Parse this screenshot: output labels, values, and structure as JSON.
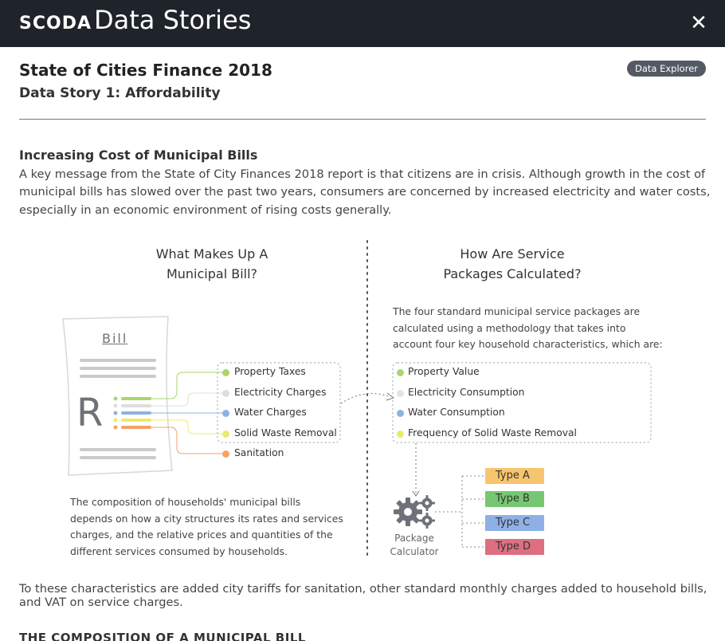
{
  "header": {
    "logo": "SCODA",
    "title": "Data Stories",
    "close_icon": "close-icon"
  },
  "page": {
    "title": "State of Cities Finance 2018",
    "subtitle": "Data Story 1: Affordability",
    "badge": "Data Explorer"
  },
  "section": {
    "heading": "Increasing Cost of Municipal Bills",
    "intro": "A key message from the State of City Finances 2018 report is that citizens are in crisis. Although growth in the cost of municipal bills has slowed over the past two years, consumers are concerned by increased electricity and water costs, especially in an economic environment of rising costs generally."
  },
  "diagram": {
    "left": {
      "title_line1": "What Makes Up A",
      "title_line2": "Municipal Bill?",
      "bill_label": "Bill",
      "bill_symbol": "R",
      "items": [
        {
          "label": "Property Taxes",
          "color": "#a9d66e"
        },
        {
          "label": "Electricity Charges",
          "color": "#dcdedf"
        },
        {
          "label": "Water Charges",
          "color": "#8fb0e6"
        },
        {
          "label": "Solid Waste Removal",
          "color": "#e9ec6b"
        },
        {
          "label": "Sanitation",
          "color": "#f3a366"
        }
      ],
      "description": "The composition of households' municipal bills depends on how a city structures its rates and services charges, and the relative prices and quantities of the different services consumed by households."
    },
    "right": {
      "title_line1": "How Are Service",
      "title_line2": "Packages Calculated?",
      "description": "The four standard municipal service packages are calculated using a methodology that takes into account four key household characteristics, which are:",
      "items": [
        {
          "label": "Property Value",
          "color": "#a9d66e"
        },
        {
          "label": "Electricity Consumption",
          "color": "#e2e3e4"
        },
        {
          "label": "Water Consumption",
          "color": "#8fb0e6"
        },
        {
          "label": "Frequency of Solid Waste Removal",
          "color": "#e9ec6b"
        }
      ],
      "calculator_line1": "Package",
      "calculator_line2": "Calculator",
      "calculator_icon": "gears-icon",
      "types": [
        {
          "label": "Type A",
          "color": "#f7c56e"
        },
        {
          "label": "Type B",
          "color": "#77c772"
        },
        {
          "label": "Type C",
          "color": "#8fb0e6"
        },
        {
          "label": "Type D",
          "color": "#de6f80"
        }
      ]
    }
  },
  "bottom": {
    "text": "To these characteristics are added city tariffs for sanitation, other standard monthly charges added to household bills, and VAT on service charges.",
    "heading": "THE COMPOSITION OF A MUNICIPAL BILL"
  },
  "colors": {
    "topbar": "#1f242b",
    "badge": "#545a63",
    "divider": "#777777"
  }
}
